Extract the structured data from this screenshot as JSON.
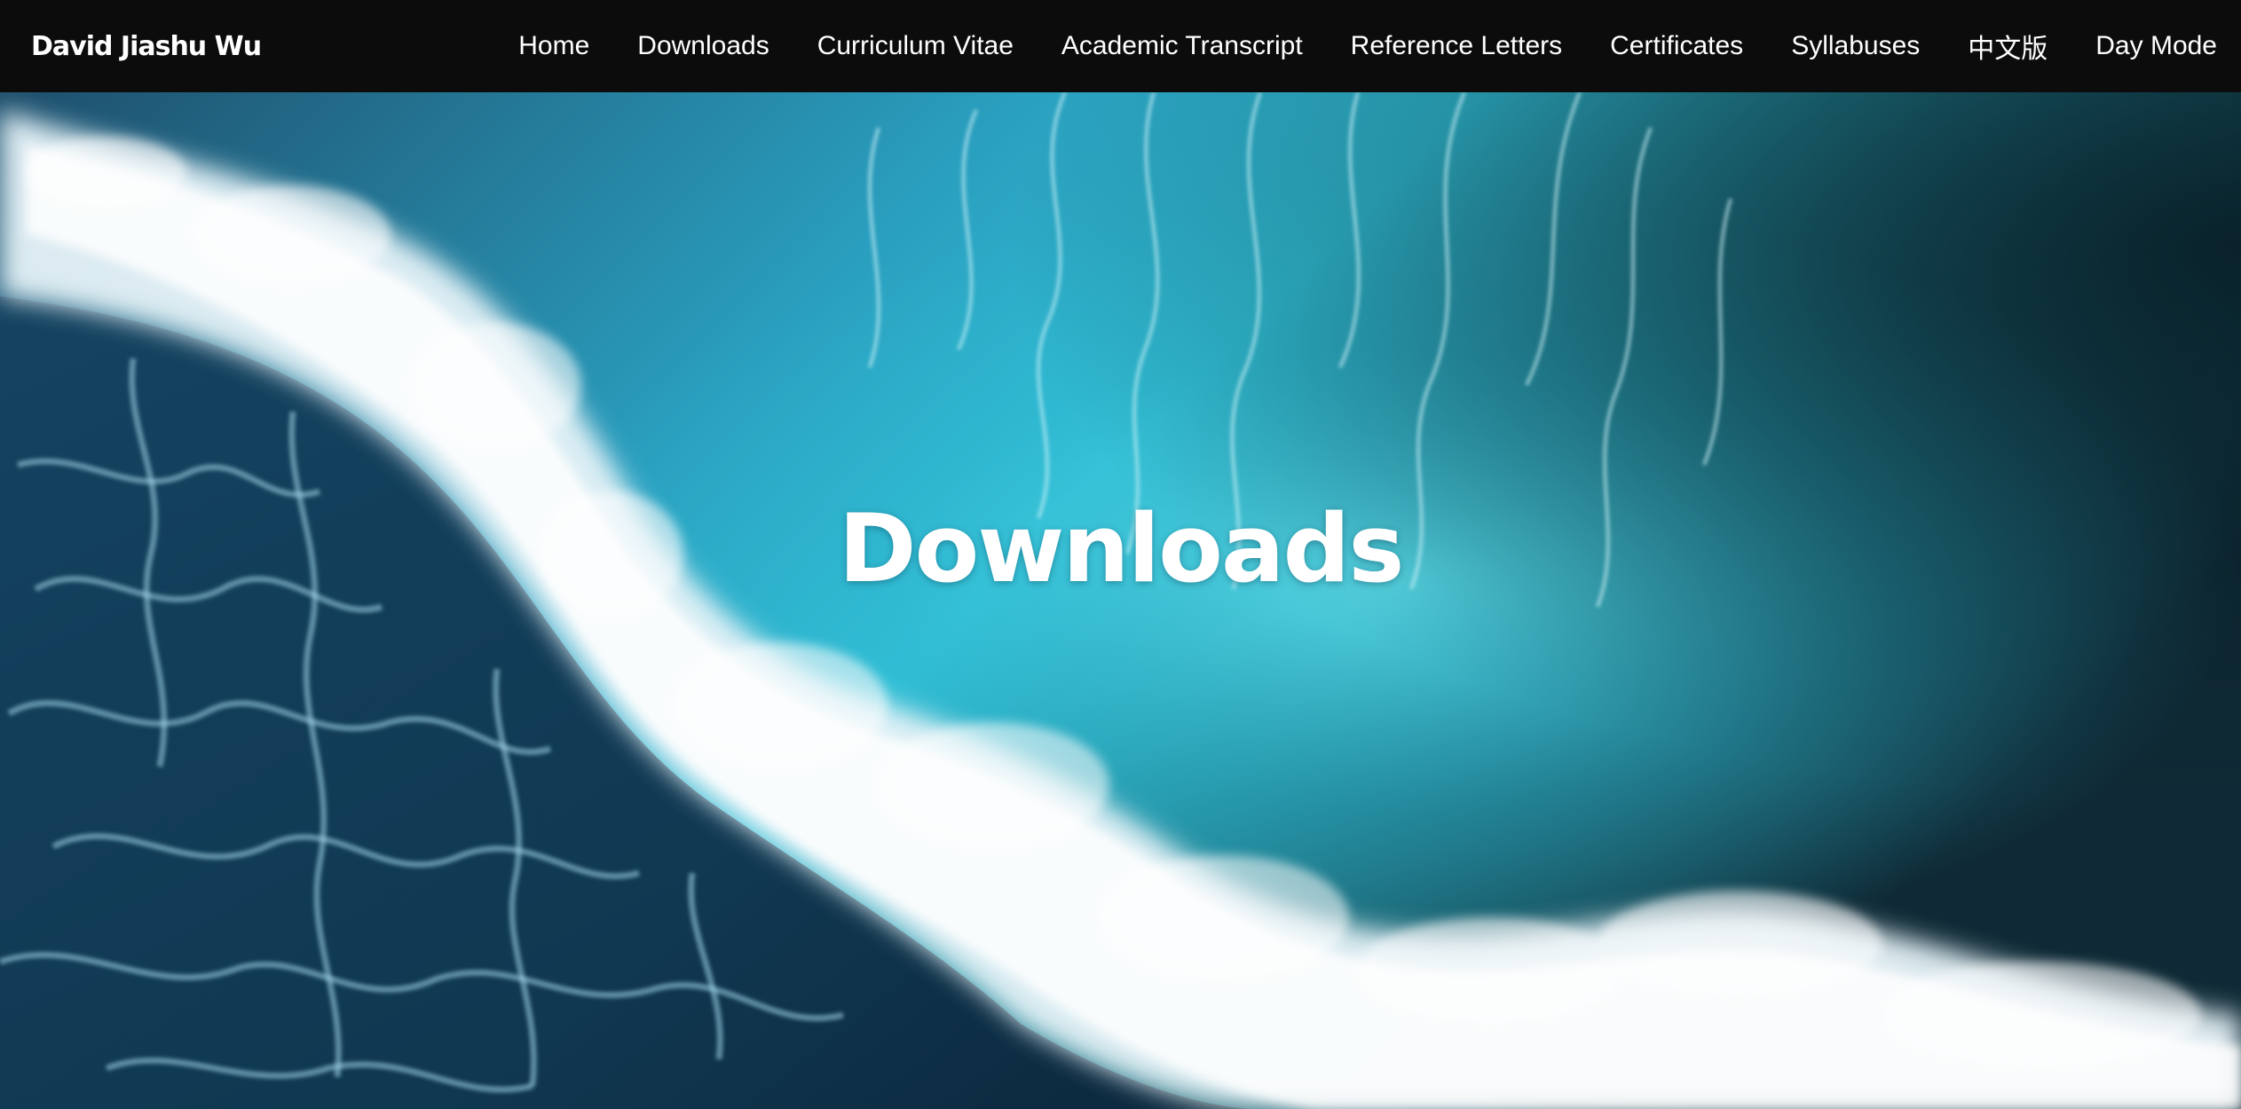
{
  "brand": "David Jiashu Wu",
  "nav": {
    "items": [
      "Home",
      "Downloads",
      "Curriculum Vitae",
      "Academic Transcript",
      "Reference Letters",
      "Certificates",
      "Syllabuses",
      "中文版",
      "Day Mode"
    ]
  },
  "hero": {
    "title": "Downloads",
    "background": "ocean-wave-aerial-image"
  },
  "colors": {
    "navbar_bg": "#0c0c0c",
    "text": "#ffffff",
    "deep_water": "#0d2c47",
    "turquoise": "#2ec3d8",
    "foam": "#e8f4f8"
  }
}
